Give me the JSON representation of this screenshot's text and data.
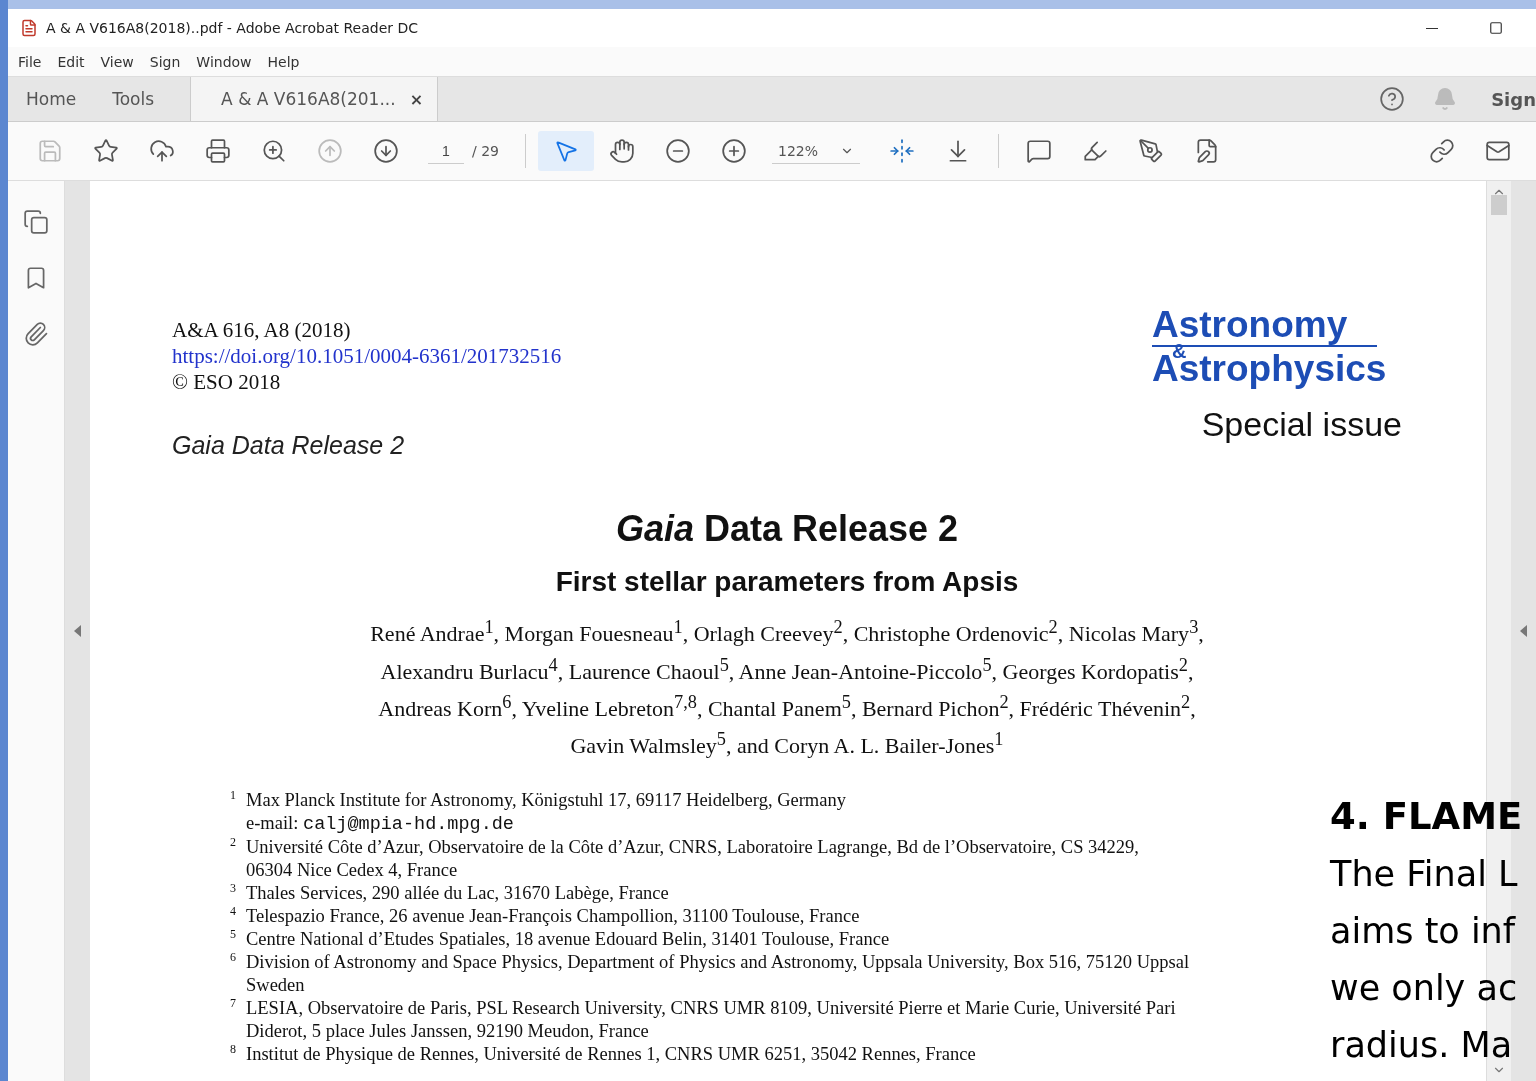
{
  "window": {
    "title": "A & A V616A8(2018)..pdf - Adobe Acrobat Reader DC"
  },
  "menu": [
    "File",
    "Edit",
    "View",
    "Sign",
    "Window",
    "Help"
  ],
  "tabs": [
    {
      "label": "Home",
      "selected": false
    },
    {
      "label": "Tools",
      "selected": false
    },
    {
      "label": "A & A V616A8(201...",
      "selected": true,
      "close": "×"
    }
  ],
  "account": {
    "label": "Sign"
  },
  "toolbar": {
    "left": [
      {
        "kind": "save",
        "disabled": true
      },
      {
        "kind": "star",
        "disabled": false
      },
      {
        "kind": "upload",
        "disabled": false
      },
      {
        "kind": "print",
        "disabled": false
      },
      {
        "kind": "find",
        "disabled": false
      },
      {
        "kind": "prev",
        "disabled": true
      },
      {
        "kind": "next",
        "disabled": false
      },
      {
        "kind": "page",
        "value": "1",
        "total": "/ 29"
      },
      {
        "kind": "separator"
      },
      {
        "kind": "select",
        "disabled": false,
        "selected": true
      },
      {
        "kind": "hand",
        "disabled": false,
        "selected": false
      },
      {
        "kind": "zoom_out",
        "disabled": false
      },
      {
        "kind": "zoom_in",
        "disabled": false
      },
      {
        "kind": "zoom",
        "value": "122%"
      },
      {
        "kind": "fit",
        "disabled": false
      },
      {
        "kind": "scroll",
        "disabled": false
      },
      {
        "kind": "separator"
      },
      {
        "kind": "comment",
        "disabled": false
      },
      {
        "kind": "highlight",
        "disabled": false
      },
      {
        "kind": "sign",
        "disabled": false
      },
      {
        "kind": "export",
        "disabled": false
      }
    ],
    "right": [
      {
        "kind": "link",
        "disabled": false
      },
      {
        "kind": "mail",
        "disabled": false
      }
    ]
  },
  "document": {
    "citation": "A&A 616, A8 (2018)",
    "doi": "https://doi.org/10.1051/0004-6361/201732516",
    "copyright": "© ESO 2018",
    "series": "Gaia Data Release 2",
    "journal": {
      "line1": "Astronomy",
      "amp": "&",
      "line2": "Astrophysics",
      "issue": "Special issue"
    },
    "title": "*Gaia* Data Release 2",
    "subtitle": "First stellar parameters from Apsis",
    "authors": [
      "René Andrae$^{1}$, Morgan Fouesneau$^{1}$, Orlagh Creevey$^{2}$, Christophe Ordenovic$^{2}$, Nicolas Mary$^{3}$,",
      "Alexandru Burlacu$^{4}$, Laurence Chaoul$^{5}$, Anne Jean-Antoine-Piccolo$^{5}$, Georges Kordopatis$^{2}$,",
      "Andreas Korn$^{6}$, Yveline Lebreton$^{7,8}$, Chantal Panem$^{5}$, Bernard Pichon$^{2}$, Frédéric Thévenin$^{2}$,",
      "Gavin Walmsley$^{5}$, and Coryn A. L. Bailer-Jones$^{1}$"
    ],
    "affiliations": [
      {
        "number": "1",
        "lines": [
          "Max Planck Institute for Astronomy, Königstuhl 17, 69117 Heidelberg, Germany"
        ],
        "email_label": "e-mail:",
        "email": "calj@mpia-hd.mpg.de"
      },
      {
        "number": "2",
        "lines": [
          "Université Côte d’Azur, Observatoire de la Côte d’Azur, CNRS, Laboratoire Lagrange, Bd de l’Observatoire, CS 34229,",
          "06304 Nice Cedex 4, France"
        ]
      },
      {
        "number": "3",
        "lines": [
          "Thales Services, 290 allée du Lac, 31670 Labège, France"
        ]
      },
      {
        "number": "4",
        "lines": [
          "Telespazio France, 26 avenue Jean-François Champollion, 31100 Toulouse, France"
        ]
      },
      {
        "number": "5",
        "lines": [
          "Centre National d’Etudes Spatiales, 18 avenue Edouard Belin, 31401 Toulouse, France"
        ]
      },
      {
        "number": "6",
        "lines": [
          "Division of Astronomy and Space Physics, Department of Physics and Astronomy, Uppsala University, Box 516, 75120 Uppsal",
          "Sweden"
        ]
      },
      {
        "number": "7",
        "lines": [
          "LESIA, Observatoire de Paris, PSL Research University, CNRS UMR 8109, Université Pierre et Marie Curie, Université Pari",
          "Diderot, 5 place Jules Janssen, 92190 Meudon, France"
        ]
      },
      {
        "number": "8",
        "lines": [
          "Institut de Physique de Rennes, Université de Rennes 1, CNRS UMR 6251, 35042 Rennes, France"
        ]
      }
    ]
  },
  "slide_overlay": {
    "heading": "4. FLAME",
    "lines": [
      "The Final L",
      "aims to inf",
      "we only ac",
      "radius. Ma"
    ]
  }
}
